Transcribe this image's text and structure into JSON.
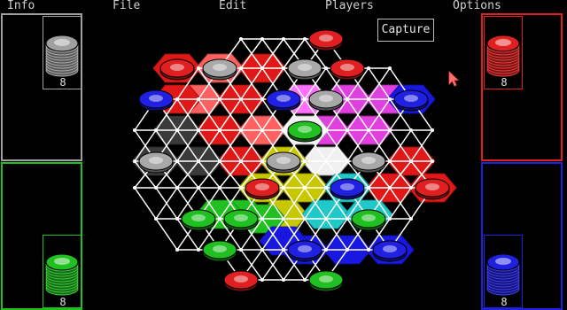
{
  "menu": {
    "info": "Info",
    "file": "File",
    "edit": "Edit",
    "players": "Players",
    "options": "Options"
  },
  "capture_label": "Capture",
  "players": [
    {
      "id": "gray",
      "color": "#a0a0a0",
      "count": "8"
    },
    {
      "id": "red",
      "color": "#e02020",
      "count": "8"
    },
    {
      "id": "green",
      "color": "#20c020",
      "count": "8"
    },
    {
      "id": "blue",
      "color": "#2020e0",
      "count": "8"
    }
  ],
  "colors": {
    "gray_zone": "#7a7a7a",
    "red_zone": "#e01818",
    "light_red": "#ff6060",
    "magenta": "#e040e0",
    "yellow": "#c8c800",
    "cyan": "#20c8c8",
    "green_zone": "#20c020",
    "blue_zone": "#1818e0",
    "white": "#f0f0f0"
  },
  "icons": {
    "cursor": "arrow-cursor-icon",
    "stack": "chip-stack-icon"
  }
}
